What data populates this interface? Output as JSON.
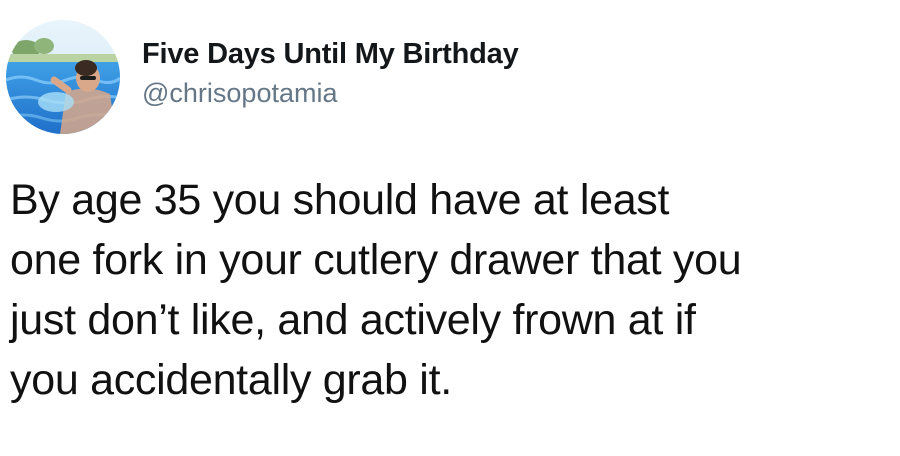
{
  "tweet": {
    "author": {
      "display_name": "Five Days Until My Birthday",
      "handle": "@chrisopotamia",
      "avatar_icon": "profile-photo-avatar"
    },
    "text": "By age 35 you should have at least\none fork in your cutlery drawer that you\njust don’t like, and actively frown at if\nyou accidentally grab it."
  },
  "colors": {
    "name": "#14171a",
    "handle": "#657786",
    "text": "#111111",
    "background": "#ffffff"
  }
}
